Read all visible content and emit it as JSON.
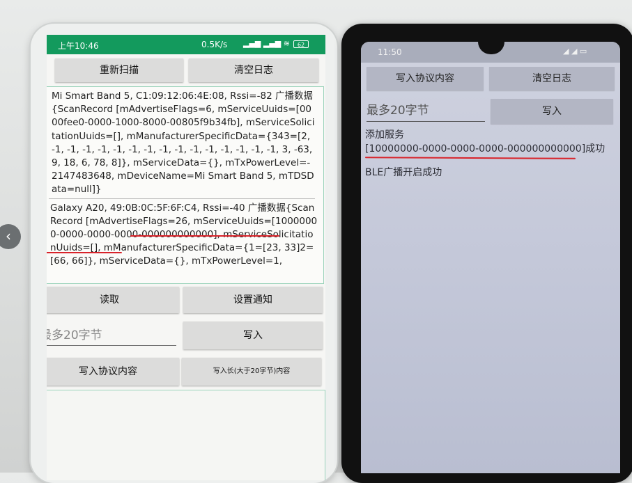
{
  "left_phone": {
    "status": {
      "time": "上午10:46",
      "speed": "0.5K/s",
      "battery": "62"
    },
    "buttons": {
      "rescan": "重新扫描",
      "clear_log": "清空日志",
      "read": "读取",
      "set_notify": "设置通知",
      "write": "写入",
      "write_protocol": "写入协议内容",
      "write_long": "写入长(大于20字节)内容"
    },
    "input_placeholder": "最多20字节",
    "log": [
      "Mi Smart Band 5, C1:09:12:06:4E:08, Rssi=-82 广播数据{ScanRecord [mAdvertiseFlags=6, mServiceUuids=[0000fee0-0000-1000-8000-00805f9b34fb], mServiceSolicitationUuids=[], mManufacturerSpecificData={343=[2, -1, -1, -1, -1, -1, -1, -1, -1, -1, -1, -1, -1, -1, -1, -1, 3, -63, 9, 18, 6, 78, 8]}, mServiceData={}, mTxPowerLevel=-2147483648, mDeviceName=Mi Smart Band 5, mTDSData=null]}",
      "Galaxy A20, 49:0B:0C:5F:6F:C4, Rssi=-40 广播数据{ScanRecord [mAdvertiseFlags=26, mServiceUuids=[10000000-0000-0000-0000-000000000000], mServiceSolicitationUuids=[], mManufacturerSpecificData={1=[23, 33]2=[66, 66]}, mServiceData={}, mTxPowerLevel=1,"
    ]
  },
  "right_phone": {
    "status": {
      "time": "11:50"
    },
    "buttons": {
      "write_protocol": "写入协议内容",
      "clear_log": "清空日志",
      "write": "写入"
    },
    "input_placeholder": "最多20字节",
    "log": [
      "添加服务",
      "[10000000-0000-0000-0000-000000000000]成功",
      "BLE广播开启成功"
    ]
  },
  "nav": {
    "prev_arrow": "‹"
  },
  "colors": {
    "status_green": "#139a5d",
    "highlight_red": "#d8232a"
  }
}
